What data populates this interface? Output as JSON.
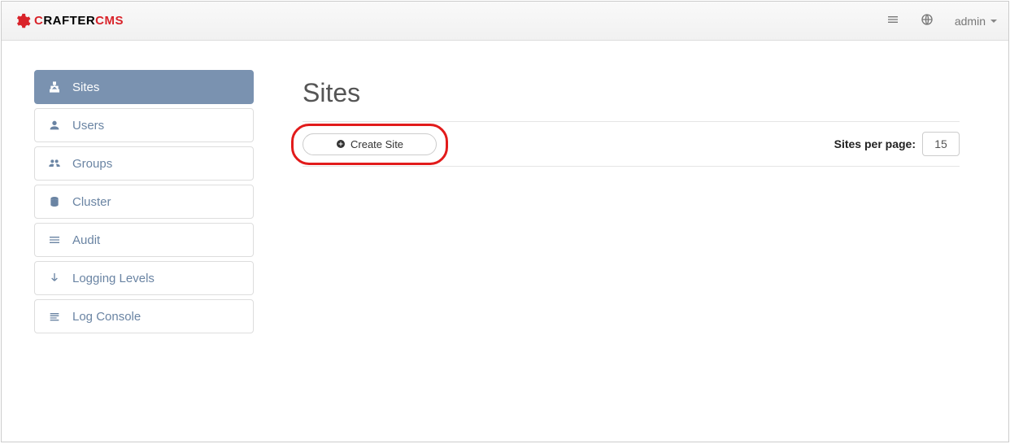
{
  "brand": {
    "part1": "C",
    "part2": "RAFTER",
    "part3": "CMS"
  },
  "topbar": {
    "user_label": "admin"
  },
  "sidebar": {
    "items": [
      {
        "label": "Sites",
        "icon": "sitemap",
        "active": true
      },
      {
        "label": "Users",
        "icon": "user",
        "active": false
      },
      {
        "label": "Groups",
        "icon": "users",
        "active": false
      },
      {
        "label": "Cluster",
        "icon": "database",
        "active": false
      },
      {
        "label": "Audit",
        "icon": "bars",
        "active": false
      },
      {
        "label": "Logging Levels",
        "icon": "arrowdown",
        "active": false
      },
      {
        "label": "Log Console",
        "icon": "lines",
        "active": false
      }
    ]
  },
  "main": {
    "title": "Sites",
    "create_label": "Create Site",
    "per_page_label": "Sites per page:",
    "per_page_value": "15"
  }
}
